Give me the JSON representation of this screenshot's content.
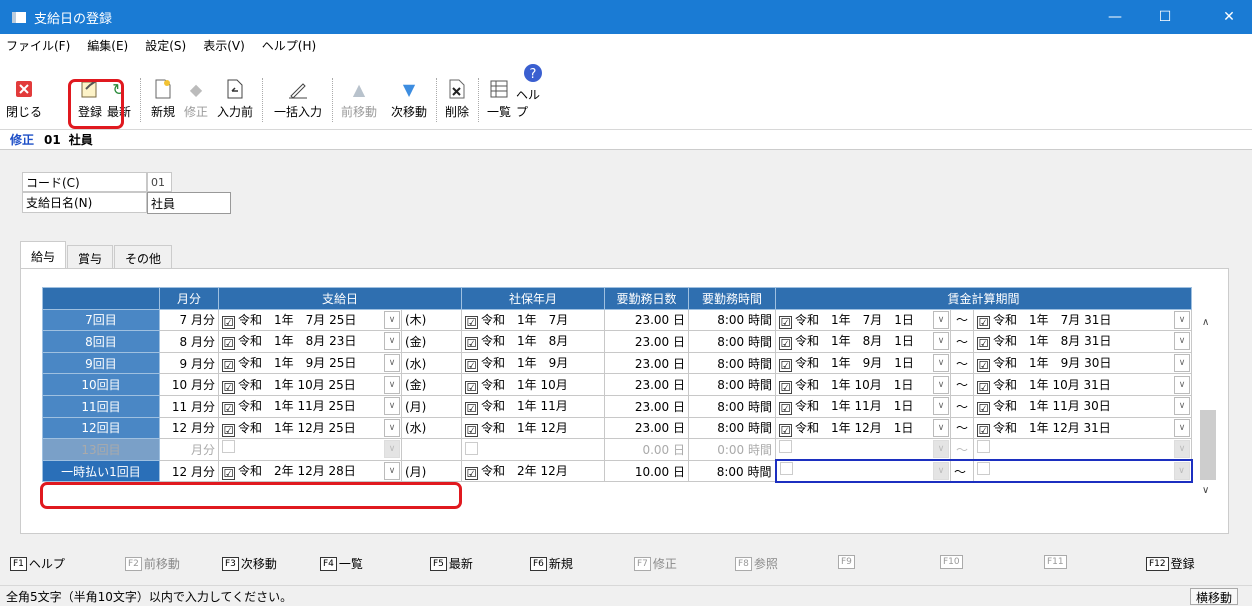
{
  "window": {
    "title": "支給日の登録",
    "minimize": "—",
    "maximize": "☐",
    "close": "✕"
  },
  "menu": [
    "ファイル(F)",
    "編集(E)",
    "設定(S)",
    "表示(V)",
    "ヘルプ(H)"
  ],
  "toolbar": {
    "close": "閉じる",
    "save": "登録",
    "refresh": "最新",
    "new": "新規",
    "edit": "修正",
    "prev_input": "入力前",
    "bulk": "一括入力",
    "prev": "前移動",
    "next": "次移動",
    "delete": "削除",
    "list": "一覧",
    "help": "ヘルプ"
  },
  "mode": {
    "label": "修正",
    "code": "01",
    "name": "社員"
  },
  "form": {
    "code_label": "コード(C)",
    "code_value": "01",
    "name_label": "支給日名(N)",
    "name_value": "社員"
  },
  "tabs": [
    "給与",
    "賞与",
    "その他"
  ],
  "grid": {
    "headers": {
      "month": "月分",
      "payday": "支給日",
      "insurance": "社保年月",
      "days": "要勤務日数",
      "hours": "要勤務時間",
      "period": "賃金計算期間"
    },
    "rows": [
      {
        "label": "7回目",
        "month": "7",
        "mu": "月分",
        "check": "☑",
        "pay": "令和　1年　7月 25日",
        "wd": "(木)",
        "ins": "令和　1年　7月",
        "days": "23.00 日",
        "hours": "8:00 時間",
        "from": "令和　1年　7月　1日",
        "to": "令和　1年　7月 31日"
      },
      {
        "label": "8回目",
        "month": "8",
        "mu": "月分",
        "check": "☑",
        "pay": "令和　1年　8月 23日",
        "wd": "(金)",
        "ins": "令和　1年　8月",
        "days": "23.00 日",
        "hours": "8:00 時間",
        "from": "令和　1年　8月　1日",
        "to": "令和　1年　8月 31日"
      },
      {
        "label": "9回目",
        "month": "9",
        "mu": "月分",
        "check": "☑",
        "pay": "令和　1年　9月 25日",
        "wd": "(水)",
        "ins": "令和　1年　9月",
        "days": "23.00 日",
        "hours": "8:00 時間",
        "from": "令和　1年　9月　1日",
        "to": "令和　1年　9月 30日"
      },
      {
        "label": "10回目",
        "month": "10",
        "mu": "月分",
        "check": "☑",
        "pay": "令和　1年 10月 25日",
        "wd": "(金)",
        "ins": "令和　1年 10月",
        "days": "23.00 日",
        "hours": "8:00 時間",
        "from": "令和　1年 10月　1日",
        "to": "令和　1年 10月 31日"
      },
      {
        "label": "11回目",
        "month": "11",
        "mu": "月分",
        "check": "☑",
        "pay": "令和　1年 11月 25日",
        "wd": "(月)",
        "ins": "令和　1年 11月",
        "days": "23.00 日",
        "hours": "8:00 時間",
        "from": "令和　1年 11月　1日",
        "to": "令和　1年 11月 30日"
      },
      {
        "label": "12回目",
        "month": "12",
        "mu": "月分",
        "check": "☑",
        "pay": "令和　1年 12月 25日",
        "wd": "(水)",
        "ins": "令和　1年 12月",
        "days": "23.00 日",
        "hours": "8:00 時間",
        "from": "令和　1年 12月　1日",
        "to": "令和　1年 12月 31日"
      },
      {
        "label": "13回目",
        "month": "",
        "mu": "月分",
        "check": "",
        "pay": "",
        "wd": "",
        "ins": "",
        "days": "0.00 日",
        "hours": "0:00 時間",
        "from": "",
        "to": ""
      },
      {
        "label": "一時払い1回目",
        "month": "12",
        "mu": "月分",
        "check": "☑",
        "pay": "令和　2年 12月 28日",
        "wd": "(月)",
        "ins": "令和　2年 12月",
        "days": "10.00 日",
        "hours": "8:00 時間",
        "from": "",
        "to": ""
      }
    ],
    "tilde": "～"
  },
  "fkeys": [
    {
      "key": "F1",
      "label": "ヘルプ"
    },
    {
      "key": "F2",
      "label": "前移動"
    },
    {
      "key": "F3",
      "label": "次移動"
    },
    {
      "key": "F4",
      "label": "一覧"
    },
    {
      "key": "F5",
      "label": "最新"
    },
    {
      "key": "F6",
      "label": "新規"
    },
    {
      "key": "F7",
      "label": "修正"
    },
    {
      "key": "F8",
      "label": "参照"
    },
    {
      "key": "F9",
      "label": ""
    },
    {
      "key": "F10",
      "label": ""
    },
    {
      "key": "F11",
      "label": ""
    },
    {
      "key": "F12",
      "label": "登録"
    }
  ],
  "status": {
    "message": "全角5文字（半角10文字）以内で入力してください。",
    "mode_button": "横移動"
  },
  "colors": {
    "titlebar": "#1a7bd4",
    "grid_header": "#2f6fb0",
    "highlight": "#e0191f",
    "selected_row_border": "#1c2fc0"
  }
}
